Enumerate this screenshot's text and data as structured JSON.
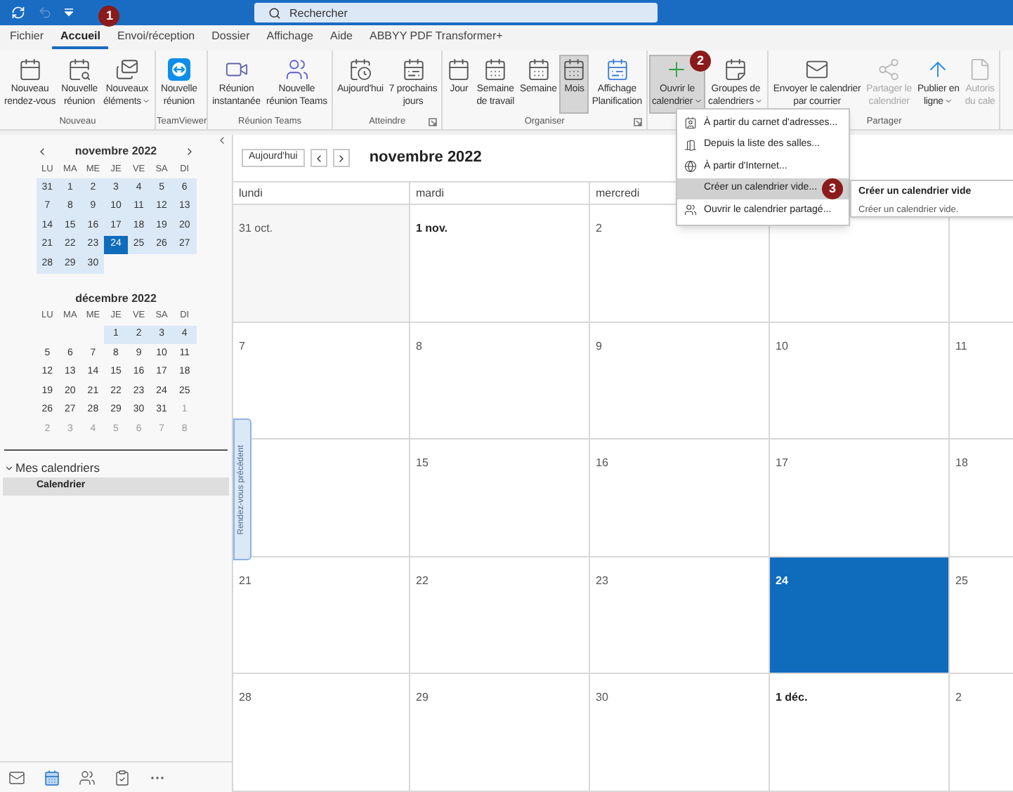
{
  "title_bar": {
    "search": {
      "placeholder": "Rechercher"
    }
  },
  "tabs": [
    {
      "label": "Fichier",
      "selected": false
    },
    {
      "label": "Accueil",
      "selected": true,
      "badge": "1"
    },
    {
      "label": "Envoi/réception",
      "selected": false
    },
    {
      "label": "Dossier",
      "selected": false
    },
    {
      "label": "Affichage",
      "selected": false
    },
    {
      "label": "Aide",
      "selected": false
    },
    {
      "label": "ABBYY PDF Transformer+",
      "selected": false
    }
  ],
  "ribbon": {
    "groups": [
      {
        "label": "Nouveau",
        "launcher": false,
        "buttons": [
          {
            "lines": [
              "Nouveau",
              "rendez-vous"
            ],
            "dropdown": false,
            "disabled": false,
            "selected": false
          },
          {
            "lines": [
              "Nouvelle",
              "réunion"
            ],
            "dropdown": false,
            "disabled": false,
            "selected": false
          },
          {
            "lines": [
              "Nouveaux",
              "éléments"
            ],
            "dropdown": true,
            "disabled": false,
            "selected": false
          }
        ]
      },
      {
        "label": "TeamViewer",
        "launcher": false,
        "buttons": [
          {
            "lines": [
              "Nouvelle",
              "réunion"
            ],
            "dropdown": false,
            "disabled": false,
            "selected": false
          }
        ]
      },
      {
        "label": "Réunion Teams",
        "launcher": false,
        "buttons": [
          {
            "lines": [
              "Réunion",
              "instantanée"
            ],
            "dropdown": false,
            "disabled": false,
            "selected": false
          },
          {
            "lines": [
              "Nouvelle",
              "réunion Teams"
            ],
            "dropdown": false,
            "disabled": false,
            "selected": false
          }
        ]
      },
      {
        "label": "Atteindre",
        "launcher": true,
        "buttons": [
          {
            "lines": [
              "Aujourd'hui"
            ],
            "dropdown": false,
            "disabled": false,
            "selected": false
          },
          {
            "lines": [
              "7 prochains",
              "jours"
            ],
            "dropdown": false,
            "disabled": false,
            "selected": false
          }
        ]
      },
      {
        "label": "Organiser",
        "launcher": true,
        "buttons": [
          {
            "lines": [
              "Jour"
            ],
            "dropdown": false,
            "disabled": false,
            "selected": false
          },
          {
            "lines": [
              "Semaine",
              "de travail"
            ],
            "dropdown": false,
            "disabled": false,
            "selected": false
          },
          {
            "lines": [
              "Semaine"
            ],
            "dropdown": false,
            "disabled": false,
            "selected": false
          },
          {
            "lines": [
              "Mois"
            ],
            "dropdown": false,
            "disabled": false,
            "selected": true
          },
          {
            "lines": [
              "Affichage",
              "Planification"
            ],
            "dropdown": false,
            "disabled": false,
            "selected": false
          }
        ]
      },
      {
        "launcher": false,
        "buttons": [
          {
            "lines": [
              "Ouvrir le",
              "calendrier"
            ],
            "dropdown": true,
            "disabled": false,
            "selected": true,
            "badge": "2"
          },
          {
            "lines": [
              "Groupes de",
              "calendriers"
            ],
            "dropdown": true,
            "disabled": false,
            "selected": false
          }
        ]
      },
      {
        "label": "Partager",
        "launcher": false,
        "buttons": [
          {
            "lines": [
              "Envoyer le calendrier",
              "par courrier"
            ],
            "dropdown": false,
            "disabled": false,
            "selected": false
          },
          {
            "lines": [
              "Partager le",
              "calendrier"
            ],
            "dropdown": false,
            "disabled": true,
            "selected": false
          },
          {
            "lines": [
              "Publier en",
              "ligne"
            ],
            "dropdown": true,
            "disabled": false,
            "selected": false
          },
          {
            "lines": [
              "Autoris",
              "du cale"
            ],
            "dropdown": false,
            "disabled": true,
            "selected": false
          }
        ]
      }
    ]
  },
  "mini_calendars": [
    {
      "title": "novembre 2022",
      "weekdays": [
        "LU",
        "MA",
        "ME",
        "JE",
        "VE",
        "SA",
        "DI"
      ],
      "weeks": [
        {
          "shaded": true,
          "days": [
            {
              "d": "31",
              "muted": false,
              "selected": false
            },
            {
              "d": "1",
              "muted": false,
              "selected": false
            },
            {
              "d": "2",
              "muted": false,
              "selected": false
            },
            {
              "d": "3",
              "muted": false,
              "selected": false
            },
            {
              "d": "4",
              "muted": false,
              "selected": false
            },
            {
              "d": "5",
              "muted": false,
              "selected": false
            },
            {
              "d": "6",
              "muted": false,
              "selected": false
            }
          ]
        },
        {
          "shaded": true,
          "days": [
            {
              "d": "7",
              "muted": false,
              "selected": false
            },
            {
              "d": "8",
              "muted": false,
              "selected": false
            },
            {
              "d": "9",
              "muted": false,
              "selected": false
            },
            {
              "d": "10",
              "muted": false,
              "selected": false
            },
            {
              "d": "11",
              "muted": false,
              "selected": false
            },
            {
              "d": "12",
              "muted": false,
              "selected": false
            },
            {
              "d": "13",
              "muted": false,
              "selected": false
            }
          ]
        },
        {
          "shaded": true,
          "days": [
            {
              "d": "14",
              "muted": false,
              "selected": false
            },
            {
              "d": "15",
              "muted": false,
              "selected": false
            },
            {
              "d": "16",
              "muted": false,
              "selected": false
            },
            {
              "d": "17",
              "muted": false,
              "selected": false
            },
            {
              "d": "18",
              "muted": false,
              "selected": false
            },
            {
              "d": "19",
              "muted": false,
              "selected": false
            },
            {
              "d": "20",
              "muted": false,
              "selected": false
            }
          ]
        },
        {
          "shaded": true,
          "days": [
            {
              "d": "21",
              "muted": false,
              "selected": false
            },
            {
              "d": "22",
              "muted": false,
              "selected": false
            },
            {
              "d": "23",
              "muted": false,
              "selected": false
            },
            {
              "d": "24",
              "muted": false,
              "selected": true
            },
            {
              "d": "25",
              "muted": false,
              "selected": false
            },
            {
              "d": "26",
              "muted": false,
              "selected": false
            },
            {
              "d": "27",
              "muted": false,
              "selected": false
            }
          ]
        },
        {
          "shaded": true,
          "days": [
            {
              "d": "28",
              "muted": false,
              "selected": false
            },
            {
              "d": "29",
              "muted": false,
              "selected": false
            },
            {
              "d": "30",
              "muted": false,
              "selected": false
            }
          ]
        }
      ]
    },
    {
      "title": "décembre 2022",
      "weekdays": [
        "LU",
        "MA",
        "ME",
        "JE",
        "VE",
        "SA",
        "DI"
      ],
      "weeks": [
        {
          "shaded": true,
          "days": [
            {
              "d": "1",
              "muted": false,
              "selected": false
            },
            {
              "d": "2",
              "muted": false,
              "selected": false
            },
            {
              "d": "3",
              "muted": false,
              "selected": false
            },
            {
              "d": "4",
              "muted": false,
              "selected": false
            }
          ]
        },
        {
          "shaded": false,
          "days": [
            {
              "d": "5",
              "muted": false,
              "selected": false
            },
            {
              "d": "6",
              "muted": false,
              "selected": false
            },
            {
              "d": "7",
              "muted": false,
              "selected": false
            },
            {
              "d": "8",
              "muted": false,
              "selected": false
            },
            {
              "d": "9",
              "muted": false,
              "selected": false
            },
            {
              "d": "10",
              "muted": false,
              "selected": false
            },
            {
              "d": "11",
              "muted": false,
              "selected": false
            }
          ]
        },
        {
          "shaded": false,
          "days": [
            {
              "d": "12",
              "muted": false,
              "selected": false
            },
            {
              "d": "13",
              "muted": false,
              "selected": false
            },
            {
              "d": "14",
              "muted": false,
              "selected": false
            },
            {
              "d": "15",
              "muted": false,
              "selected": false
            },
            {
              "d": "16",
              "muted": false,
              "selected": false
            },
            {
              "d": "17",
              "muted": false,
              "selected": false
            },
            {
              "d": "18",
              "muted": false,
              "selected": false
            }
          ]
        },
        {
          "shaded": false,
          "days": [
            {
              "d": "19",
              "muted": false,
              "selected": false
            },
            {
              "d": "20",
              "muted": false,
              "selected": false
            },
            {
              "d": "21",
              "muted": false,
              "selected": false
            },
            {
              "d": "22",
              "muted": false,
              "selected": false
            },
            {
              "d": "23",
              "muted": false,
              "selected": false
            },
            {
              "d": "24",
              "muted": false,
              "selected": false
            },
            {
              "d": "25",
              "muted": false,
              "selected": false
            }
          ]
        },
        {
          "shaded": false,
          "days": [
            {
              "d": "26",
              "muted": false,
              "selected": false
            },
            {
              "d": "27",
              "muted": false,
              "selected": false
            },
            {
              "d": "28",
              "muted": false,
              "selected": false
            },
            {
              "d": "29",
              "muted": false,
              "selected": false
            },
            {
              "d": "30",
              "muted": false,
              "selected": false
            },
            {
              "d": "31",
              "muted": false,
              "selected": false
            },
            {
              "d": "1",
              "muted": true,
              "selected": false
            }
          ]
        },
        {
          "shaded": false,
          "days": [
            {
              "d": "2",
              "muted": true,
              "selected": false
            },
            {
              "d": "3",
              "muted": true,
              "selected": false
            },
            {
              "d": "4",
              "muted": true,
              "selected": false
            },
            {
              "d": "5",
              "muted": true,
              "selected": false
            },
            {
              "d": "6",
              "muted": true,
              "selected": false
            },
            {
              "d": "7",
              "muted": true,
              "selected": false
            },
            {
              "d": "8",
              "muted": true,
              "selected": false
            }
          ]
        }
      ]
    }
  ],
  "folders": {
    "label": "Mes calendriers",
    "expanded": true,
    "children": [
      {
        "label": "Calendrier",
        "selected": true
      }
    ]
  },
  "nav": [
    {
      "selected": false
    },
    {
      "selected": true
    },
    {
      "selected": false
    },
    {
      "selected": false
    },
    {
      "selected": false
    }
  ],
  "calendar": {
    "today_button": "Aujourd'hui",
    "title": "novembre 2022",
    "day_names": [
      "lundi",
      "mardi",
      "mercredi"
    ],
    "previous_tab": "Rendez-vous précédent",
    "weeks": [
      [
        {
          "label": "31 oct.",
          "month_start": false,
          "selected": false
        },
        {
          "label": "1 nov.",
          "month_start": true,
          "selected": false
        },
        {
          "label": "2",
          "month_start": false,
          "selected": false
        }
      ],
      [
        {
          "label": "7",
          "month_start": false,
          "selected": false
        },
        {
          "label": "8",
          "month_start": false,
          "selected": false
        },
        {
          "label": "9",
          "month_start": false,
          "selected": false
        },
        {
          "label": "10",
          "month_start": false,
          "selected": false
        },
        {
          "label": "11",
          "month_start": false,
          "selected": false
        }
      ],
      [
        {
          "label": "15",
          "month_start": false,
          "selected": false
        },
        {
          "label": "16",
          "month_start": false,
          "selected": false
        },
        {
          "label": "17",
          "month_start": false,
          "selected": false
        },
        {
          "label": "18",
          "month_start": false,
          "selected": false
        }
      ],
      [
        {
          "label": "21",
          "month_start": false,
          "selected": false
        },
        {
          "label": "22",
          "month_start": false,
          "selected": false
        },
        {
          "label": "23",
          "month_start": false,
          "selected": false
        },
        {
          "label": "24",
          "month_start": false,
          "selected": true
        },
        {
          "label": "25",
          "month_start": false,
          "selected": false
        }
      ],
      [
        {
          "label": "28",
          "month_start": false,
          "selected": false
        },
        {
          "label": "29",
          "month_start": false,
          "selected": false
        },
        {
          "label": "30",
          "month_start": false,
          "selected": false
        },
        {
          "label": "1 déc.",
          "month_start": true,
          "selected": false
        },
        {
          "label": "2",
          "month_start": false,
          "selected": false
        }
      ]
    ]
  },
  "open_menu": {
    "items": [
      {
        "label": "À partir du carnet d'adresses...",
        "selected": false
      },
      {
        "label": "Depuis la liste des salles...",
        "selected": false
      },
      {
        "label": "À partir d'Internet...",
        "selected": false
      },
      {
        "label": "Créer un calendrier vide...",
        "selected": true,
        "badge": "3"
      },
      {
        "label": "Ouvrir le calendrier partagé...",
        "selected": false
      }
    ]
  },
  "tooltip": {
    "title": "Créer un calendrier vide",
    "text": "Créer un calendrier vide."
  }
}
